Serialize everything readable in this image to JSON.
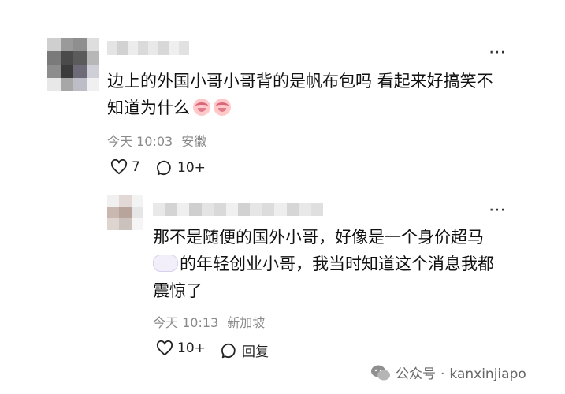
{
  "comment1": {
    "text_line1": "边上的外国小哥小哥背的是帆布包吗 看起来好搞笑不",
    "text_line2": "知道为什么",
    "time": "今天 10:03",
    "location": "安徽",
    "likes": "7",
    "replies": "10+",
    "emojis": [
      "crying-face",
      "crying-face"
    ]
  },
  "comment2": {
    "text_line1": "那不是随便的国外小哥，好像是一个身价超马",
    "text_line2": "的年轻创业小哥，我当时知道这个消息我都",
    "text_line3": "震惊了",
    "inline_emoji": "cloud",
    "time": "今天 10:13",
    "location": "新加坡",
    "likes": "10+",
    "reply_label": "回复"
  },
  "more_glyph": "⋯",
  "watermark": {
    "label": "公众号",
    "separator": "·",
    "account": "kanxinjiapo"
  },
  "colors": {
    "meta_gray": "#8a8a8a",
    "text_main": "#111111"
  }
}
